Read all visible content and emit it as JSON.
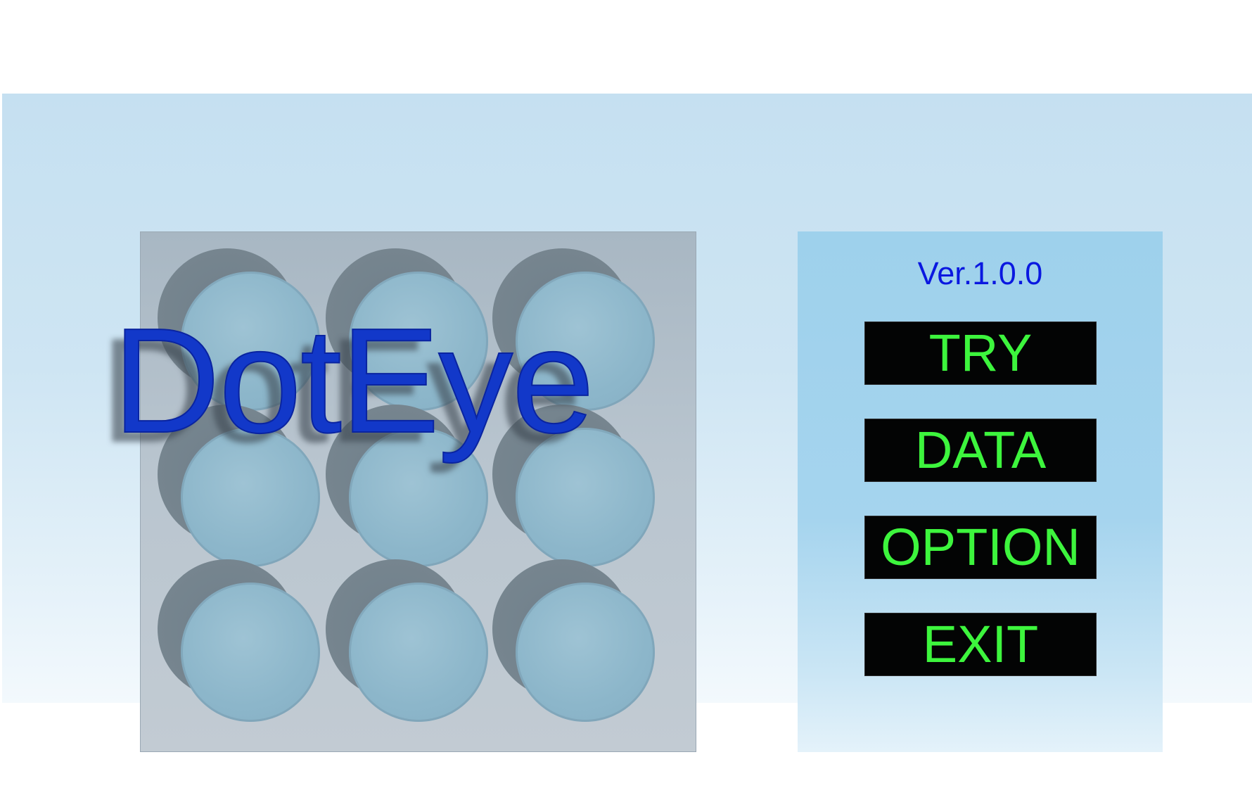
{
  "app": {
    "title": "DotEye",
    "version": "Ver.1.0.0"
  },
  "board": {
    "rows": 3,
    "cols": 3,
    "hole_count": 9
  },
  "menu": {
    "try_label": "TRY",
    "data_label": "DATA",
    "option_label": "OPTION",
    "exit_label": "EXIT"
  },
  "colors": {
    "title": "#1238c9",
    "version": "#0a18e0",
    "button_bg": "#030404",
    "button_text": "#3df53d",
    "board": "#b9c5cf",
    "hole": "#8cb6ca"
  }
}
